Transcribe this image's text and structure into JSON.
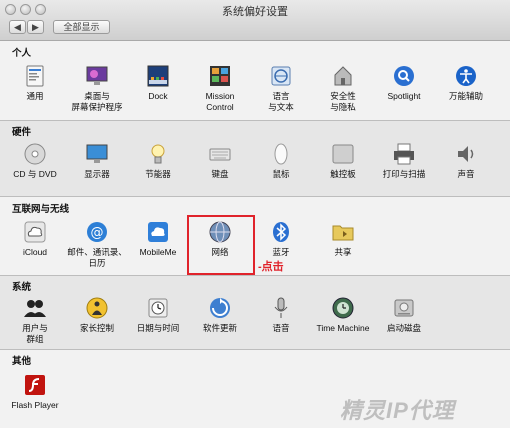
{
  "window": {
    "title": "系统偏好设置",
    "show_all": "全部显示"
  },
  "sections": [
    {
      "header": "个人",
      "items": [
        {
          "label": "通用",
          "icon": "general-icon"
        },
        {
          "label": "桌面与\n屏幕保护程序",
          "icon": "desktop-icon"
        },
        {
          "label": "Dock",
          "icon": "dock-icon"
        },
        {
          "label": "Mission\nControl",
          "icon": "mission-control-icon"
        },
        {
          "label": "语言\n与文本",
          "icon": "language-icon"
        },
        {
          "label": "安全性\n与隐私",
          "icon": "security-icon"
        },
        {
          "label": "Spotlight",
          "icon": "spotlight-icon"
        },
        {
          "label": "万能辅助",
          "icon": "accessibility-icon"
        }
      ]
    },
    {
      "header": "硬件",
      "items": [
        {
          "label": "CD 与 DVD",
          "icon": "cd-icon"
        },
        {
          "label": "显示器",
          "icon": "display-icon"
        },
        {
          "label": "节能器",
          "icon": "energy-saver-icon"
        },
        {
          "label": "键盘",
          "icon": "keyboard-icon"
        },
        {
          "label": "鼠标",
          "icon": "mouse-icon"
        },
        {
          "label": "触控板",
          "icon": "trackpad-icon"
        },
        {
          "label": "打印与扫描",
          "icon": "printer-icon"
        },
        {
          "label": "声音",
          "icon": "sound-icon"
        }
      ]
    },
    {
      "header": "互联网与无线",
      "items": [
        {
          "label": "iCloud",
          "icon": "icloud-icon"
        },
        {
          "label": "邮件、通讯录、\n日历",
          "icon": "mail-icon"
        },
        {
          "label": "MobileMe",
          "icon": "mobileme-icon"
        },
        {
          "label": "网络",
          "icon": "network-icon"
        },
        {
          "label": "蓝牙",
          "icon": "bluetooth-icon"
        },
        {
          "label": "共享",
          "icon": "sharing-icon"
        }
      ]
    },
    {
      "header": "系统",
      "items": [
        {
          "label": "用户与\n群组",
          "icon": "users-icon"
        },
        {
          "label": "家长控制",
          "icon": "parental-icon"
        },
        {
          "label": "日期与时间",
          "icon": "clock-icon"
        },
        {
          "label": "软件更新",
          "icon": "update-icon"
        },
        {
          "label": "语音",
          "icon": "microphone-icon"
        },
        {
          "label": "Time Machine",
          "icon": "time-machine-icon"
        },
        {
          "label": "启动磁盘",
          "icon": "disk-icon"
        }
      ]
    },
    {
      "header": "其他",
      "items": [
        {
          "label": "Flash Player",
          "icon": "flash-icon"
        }
      ]
    }
  ],
  "annotation": "-点击",
  "watermark": "精灵IP代理",
  "colors": {
    "highlight": "#e0232b"
  }
}
